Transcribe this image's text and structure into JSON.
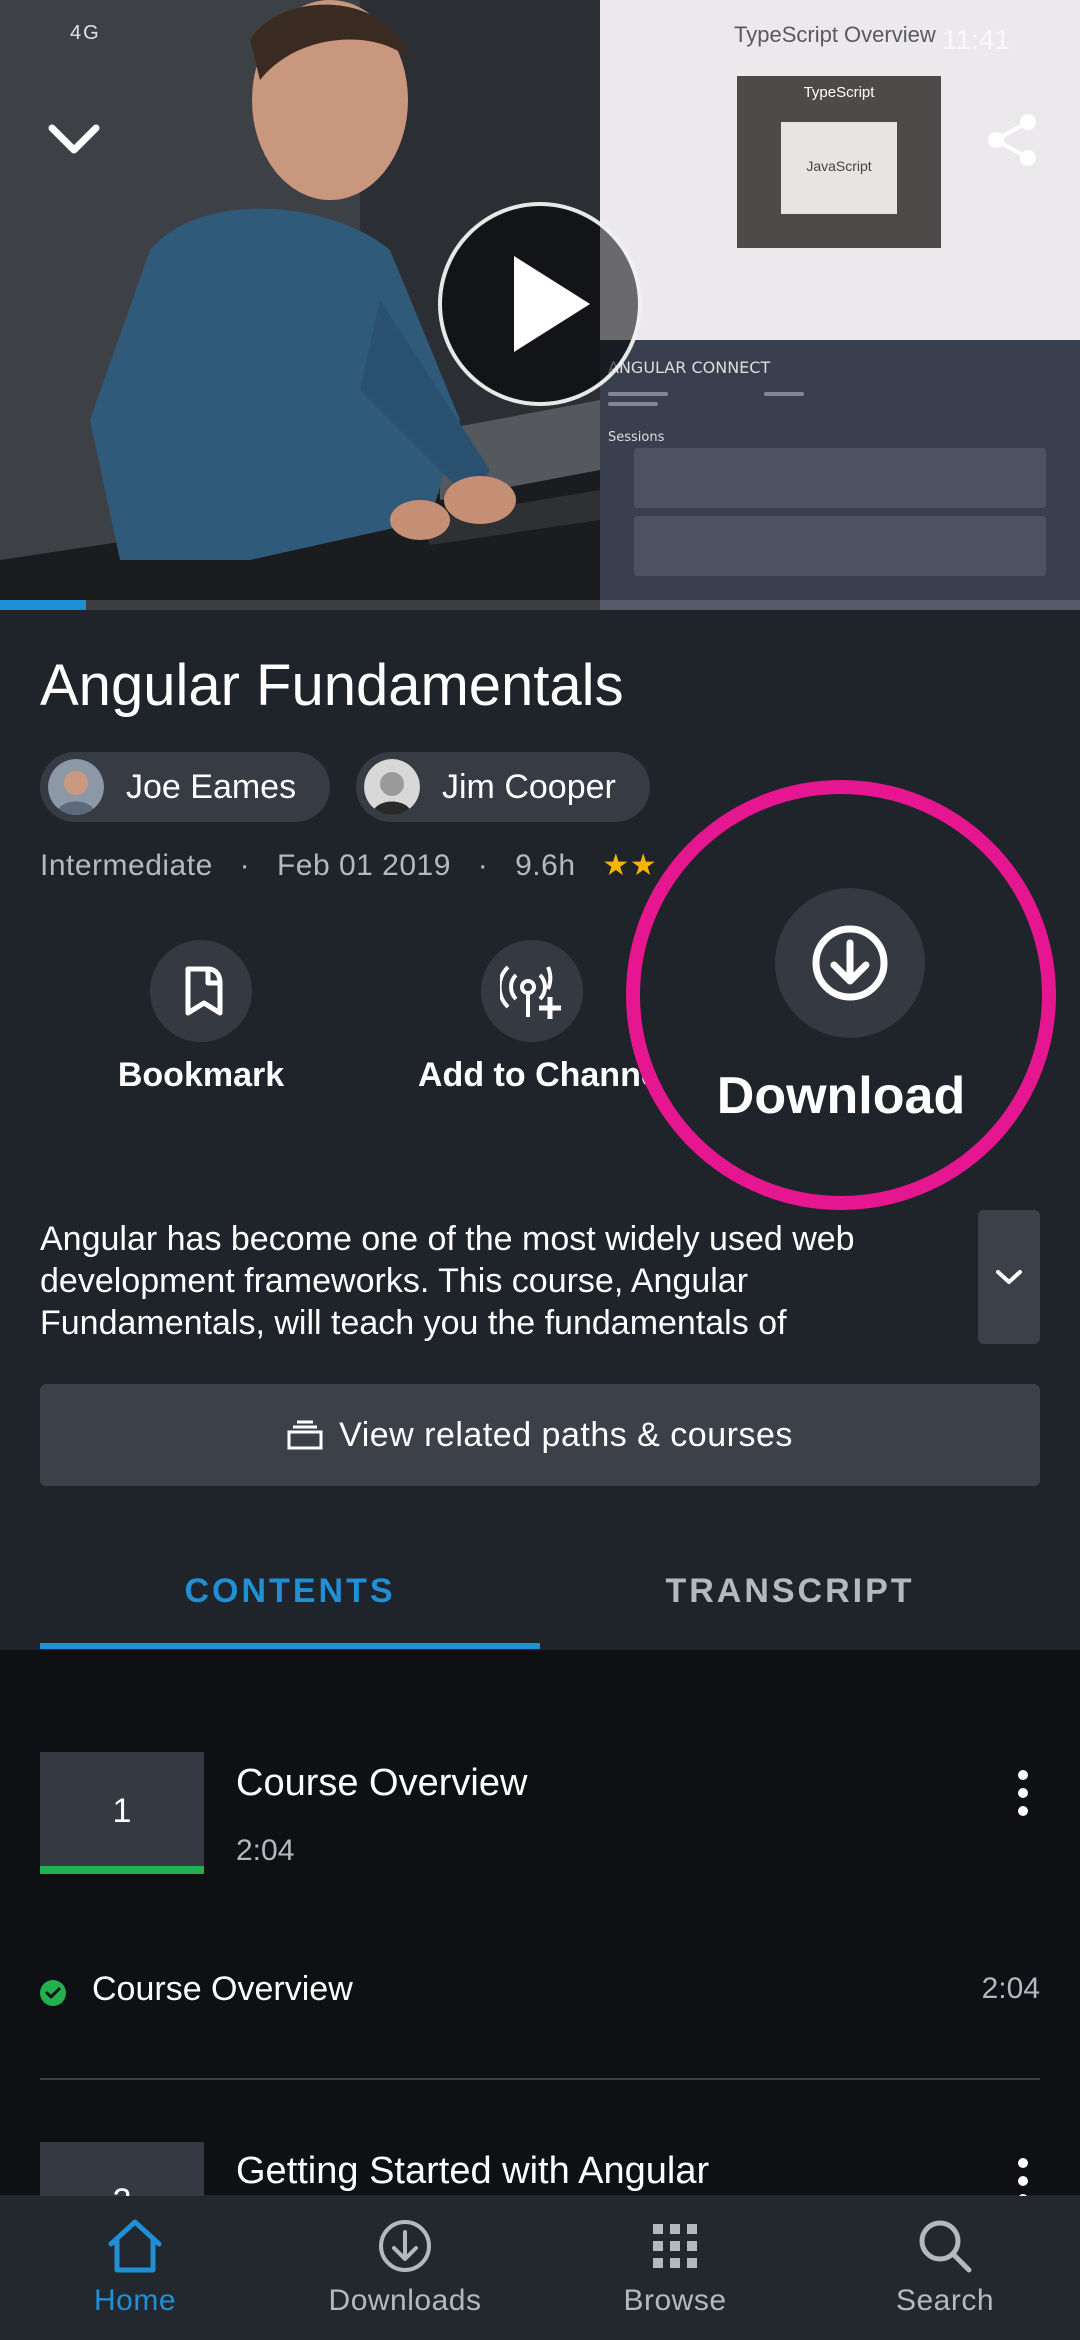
{
  "status_bar": {
    "left": "4G",
    "right": "11:41"
  },
  "video": {
    "slide_title": "TypeScript Overview",
    "outer_box_label": "TypeScript",
    "inner_box_label": "JavaScript",
    "screen_title": "ANGULAR CONNECT",
    "screen_sessions": "Sessions",
    "progress_fraction": 0.08
  },
  "course": {
    "title": "Angular Fundamentals",
    "authors": [
      "Joe Eames",
      "Jim Cooper"
    ],
    "level": "Intermediate",
    "date": "Feb 01 2019",
    "duration": "9.6h",
    "stars": "★★",
    "separator": "·"
  },
  "actions": {
    "bookmark": "Bookmark",
    "add_to_channel": "Add to Channel",
    "download": "Download"
  },
  "description": "Angular has become one of the most widely used web development frameworks. This course, Angular Fundamentals, will teach you the fundamentals of",
  "related_button": "View related paths & courses",
  "tabs": {
    "contents": "CONTENTS",
    "transcript": "TRANSCRIPT"
  },
  "modules": [
    {
      "number": "1",
      "title": "Course Overview",
      "duration": "2:04"
    },
    {
      "number": "2",
      "title": "Getting Started with Angular",
      "duration": ""
    }
  ],
  "clips": [
    {
      "title": "Course Overview",
      "duration": "2:04"
    }
  ],
  "bottom_nav": {
    "home": "Home",
    "downloads": "Downloads",
    "browse": "Browse",
    "search": "Search"
  },
  "colors": {
    "accent": "#1f8fd6",
    "highlight_ring": "#e5168f",
    "complete": "#23b04f",
    "stars": "#f4b400"
  }
}
